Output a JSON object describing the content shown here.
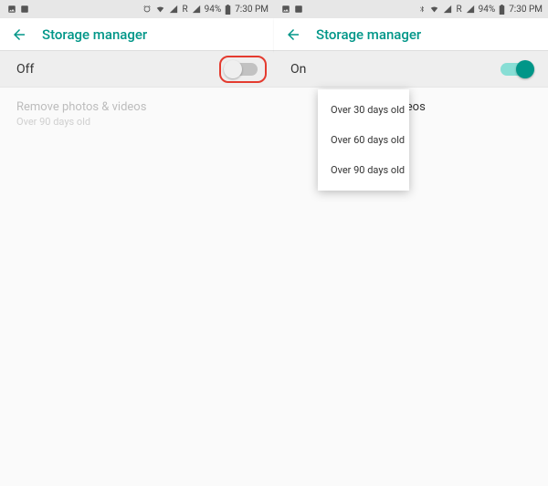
{
  "status": {
    "battery": "94%",
    "time": "7:30 PM",
    "network_label": "R"
  },
  "appbar": {
    "title": "Storage manager"
  },
  "left": {
    "toggle_label": "Off",
    "pref_title": "Remove photos & videos",
    "pref_sub": "Over 90 days old"
  },
  "right": {
    "toggle_label": "On",
    "pref_title_partial": "videos",
    "dropdown": {
      "opt0": "Over 30 days old",
      "opt1": "Over 60 days old",
      "opt2": "Over 90 days old"
    }
  }
}
